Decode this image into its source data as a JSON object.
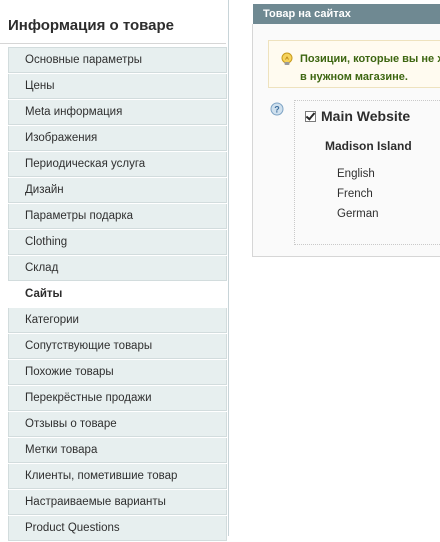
{
  "sidebar": {
    "title": "Информация о товаре",
    "items": [
      {
        "label": "Основные параметры"
      },
      {
        "label": "Цены"
      },
      {
        "label": "Meta информация"
      },
      {
        "label": "Изображения"
      },
      {
        "label": "Периодическая услуга"
      },
      {
        "label": "Дизайн"
      },
      {
        "label": "Параметры подарка"
      },
      {
        "label": "Clothing"
      },
      {
        "label": "Склад"
      },
      {
        "label": "Сайты",
        "active": true
      },
      {
        "label": "Категории"
      },
      {
        "label": "Сопутствующие товары"
      },
      {
        "label": "Похожие товары"
      },
      {
        "label": "Перекрёстные продажи"
      },
      {
        "label": "Отзывы о товаре"
      },
      {
        "label": "Метки товара"
      },
      {
        "label": "Клиенты, пометившие товар"
      },
      {
        "label": "Настраиваемые варианты"
      },
      {
        "label": "Product Questions"
      }
    ]
  },
  "panel": {
    "header": "Товар на сайтах",
    "notice_line1": "Позиции, которые вы не х",
    "notice_line2": "в нужном магазине.",
    "website": {
      "name": "Main Website",
      "checked": true,
      "store": "Madison Island",
      "views": [
        "English",
        "French",
        "German"
      ]
    }
  },
  "icons": {
    "notice": "lightbulb-icon",
    "help": "help-icon"
  },
  "colors": {
    "header_bg": "#6f8992",
    "tab_bg": "#e7efef",
    "notice_text": "#3d6611",
    "notice_bg": "#fffbf0"
  }
}
